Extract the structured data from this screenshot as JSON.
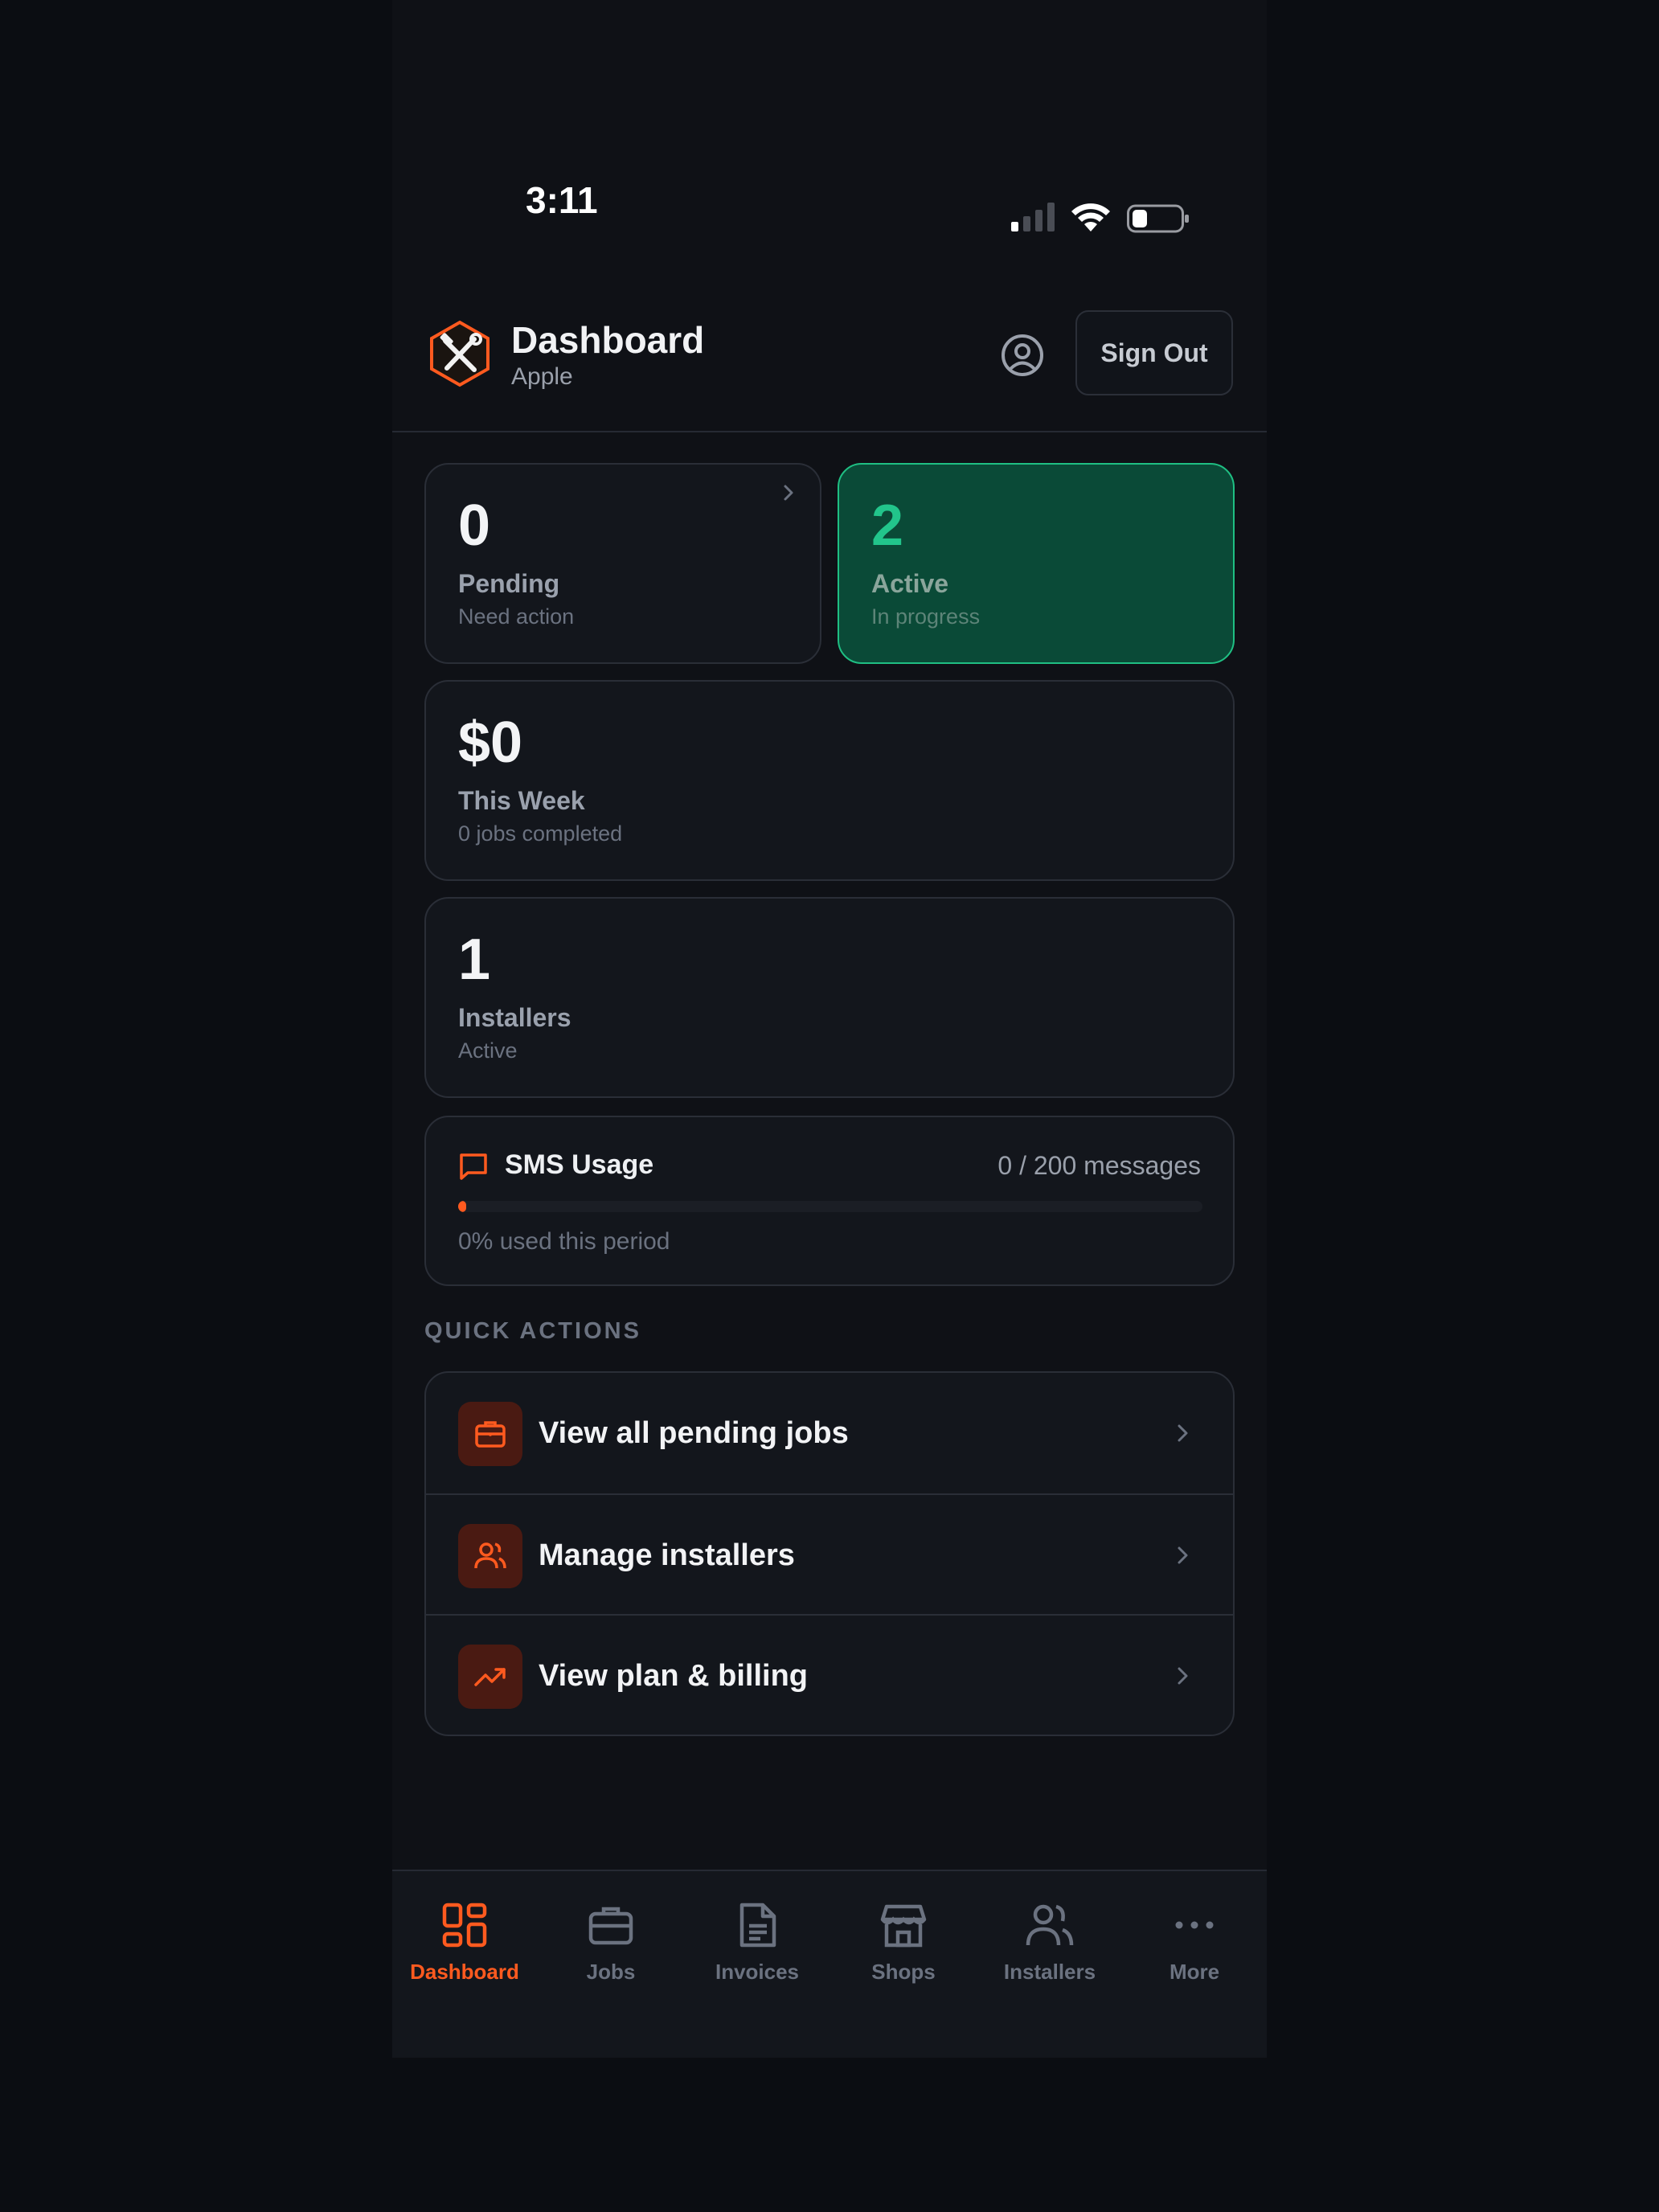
{
  "status_bar": {
    "time": "3:11"
  },
  "header": {
    "title": "Dashboard",
    "subtitle": "Apple",
    "sign_out_label": "Sign Out"
  },
  "stats": {
    "pending": {
      "value": "0",
      "label": "Pending",
      "sub": "Need action"
    },
    "active": {
      "value": "2",
      "label": "Active",
      "sub": "In progress"
    },
    "week": {
      "value": "$0",
      "label": "This Week",
      "sub": "0 jobs completed"
    },
    "installers": {
      "value": "1",
      "label": "Installers",
      "sub": "Active"
    }
  },
  "sms": {
    "title": "SMS Usage",
    "count": "0 / 200 messages",
    "note": "0% used this period",
    "used_percent": 0
  },
  "quick_actions": {
    "heading": "QUICK ACTIONS",
    "items": [
      {
        "label": "View all pending jobs",
        "icon": "briefcase-icon"
      },
      {
        "label": "Manage installers",
        "icon": "users-icon"
      },
      {
        "label": "View plan & billing",
        "icon": "trending-up-icon"
      }
    ]
  },
  "bottom_nav": {
    "items": [
      {
        "label": "Dashboard",
        "icon": "dashboard-icon"
      },
      {
        "label": "Jobs",
        "icon": "briefcase-icon"
      },
      {
        "label": "Invoices",
        "icon": "file-icon"
      },
      {
        "label": "Shops",
        "icon": "store-icon"
      },
      {
        "label": "Installers",
        "icon": "users-icon"
      },
      {
        "label": "More",
        "icon": "more-icon"
      }
    ],
    "current": "Dashboard"
  },
  "colors": {
    "accent": "#ff5a1f",
    "active_green": "#22c58b",
    "background": "#0f1116"
  }
}
